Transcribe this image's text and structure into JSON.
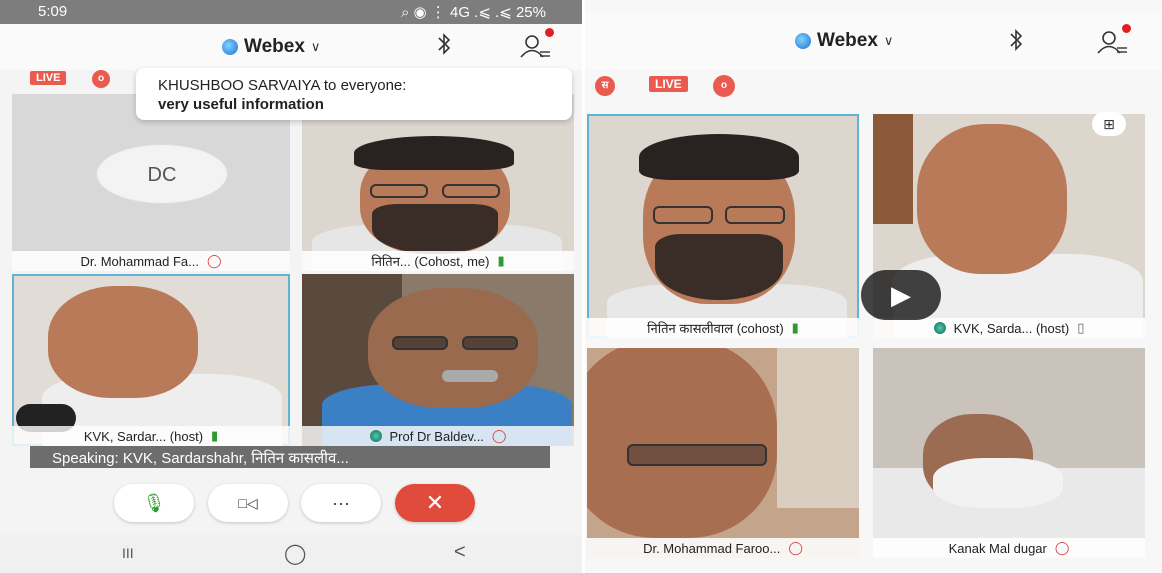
{
  "left": {
    "status": {
      "time": "5:09",
      "icons": "⌕ ◉ ⋮ 4G .⩽ .⩽",
      "battery": "25%"
    },
    "header": {
      "brand": "Webex",
      "chevron": "∨"
    },
    "badges": {
      "live": "LIVE",
      "rec": "o"
    },
    "toast": {
      "sender": "KHUSHBOO SARVAIYA to everyone:",
      "message": "very useful information"
    },
    "tiles": [
      {
        "initials": "DC",
        "caption": "Dr. Mohammad Fa...",
        "mic": "off"
      },
      {
        "caption": "नितिन... (Cohost, me)",
        "mic": "on"
      },
      {
        "caption": "KVK, Sardar... (host)",
        "mic": "on"
      },
      {
        "caption": "Prof Dr Baldev...",
        "mic": "off"
      }
    ],
    "speaking": "Speaking: KVK, Sardarshahr, नितिन कासलीव...",
    "controls": {
      "mic": "🎙",
      "video": "□◁",
      "more": "···",
      "end": "✕"
    },
    "nav": {
      "recent": "III",
      "home": "◯",
      "back": "<"
    }
  },
  "right": {
    "header": {
      "brand": "Webex",
      "chevron": "∨"
    },
    "badges": {
      "lock": "स",
      "live": "LIVE",
      "rec": "o"
    },
    "tiles": [
      {
        "caption": "नितिन कासलीवाल (cohost)",
        "mic": "on"
      },
      {
        "caption": "KVK, Sarda... (host)",
        "mic": "on"
      },
      {
        "caption": "Dr. Mohammad Faroo...",
        "mic": "off"
      },
      {
        "caption": "Kanak Mal dugar",
        "mic": "off"
      }
    ],
    "grid_icon": "⊞",
    "play_icon": "▶"
  },
  "colors": {
    "live": "#ea5a4f",
    "mic_on": "#2c9a2c",
    "mic_off": "#d23a3a",
    "end_call": "#e04b3c",
    "selected": "#5fb4d6"
  }
}
